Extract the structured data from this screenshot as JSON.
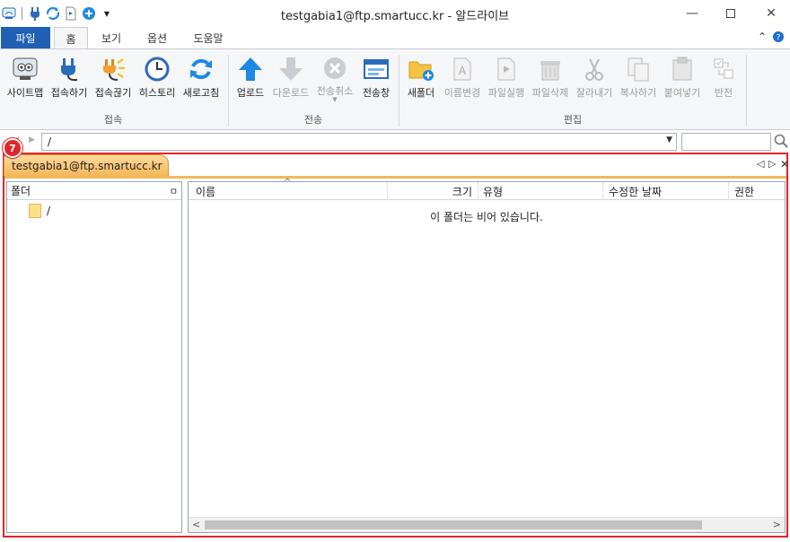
{
  "window": {
    "title": "testgabia1@ftp.smartucc.kr - 알드라이브"
  },
  "ribbon": {
    "tabs": [
      {
        "label": "파일"
      },
      {
        "label": "홈"
      },
      {
        "label": "보기"
      },
      {
        "label": "옵션"
      },
      {
        "label": "도움말"
      }
    ],
    "groups": {
      "connect": {
        "label": "접속",
        "buttons": [
          {
            "label": "사이트맵",
            "icon": "sitemap-icon"
          },
          {
            "label": "접속하기",
            "icon": "plug-connect-icon"
          },
          {
            "label": "접속끊기",
            "icon": "plug-disconnect-icon"
          },
          {
            "label": "히스토리",
            "icon": "clock-history-icon"
          },
          {
            "label": "새로고침",
            "icon": "refresh-icon"
          }
        ]
      },
      "transfer": {
        "label": "전송",
        "buttons": [
          {
            "label": "업로드",
            "icon": "upload-arrow-icon"
          },
          {
            "label": "다운로드",
            "icon": "download-arrow-icon"
          },
          {
            "label": "전송취소",
            "icon": "cancel-transfer-icon"
          },
          {
            "label": "전송창",
            "icon": "transfer-window-icon"
          }
        ]
      },
      "edit": {
        "label": "편집",
        "buttons": [
          {
            "label": "새폴더",
            "icon": "new-folder-icon"
          },
          {
            "label": "이름변경",
            "icon": "rename-icon"
          },
          {
            "label": "파일실행",
            "icon": "run-file-icon"
          },
          {
            "label": "파일삭제",
            "icon": "trash-icon"
          },
          {
            "label": "잘라내기",
            "icon": "scissors-icon"
          },
          {
            "label": "복사하기",
            "icon": "copy-icon"
          },
          {
            "label": "붙여넣기",
            "icon": "paste-icon"
          },
          {
            "label": "반전",
            "icon": "invert-selection-icon"
          }
        ]
      }
    }
  },
  "address": {
    "path": "/"
  },
  "session": {
    "marker": "7",
    "tab_label": "testgabia1@ftp.smartucc.kr"
  },
  "folder_pane": {
    "header": "폴더",
    "tree": [
      {
        "label": "/"
      }
    ]
  },
  "file_list": {
    "columns": [
      "이름",
      "크기",
      "유형",
      "수정한 날짜",
      "권한"
    ],
    "empty_message": "이 폴더는 비어 있습니다."
  },
  "colors": {
    "file_tab": "#1f5fb4",
    "highlight_frame": "#e3242b",
    "session_tab": "#f3b75a"
  }
}
